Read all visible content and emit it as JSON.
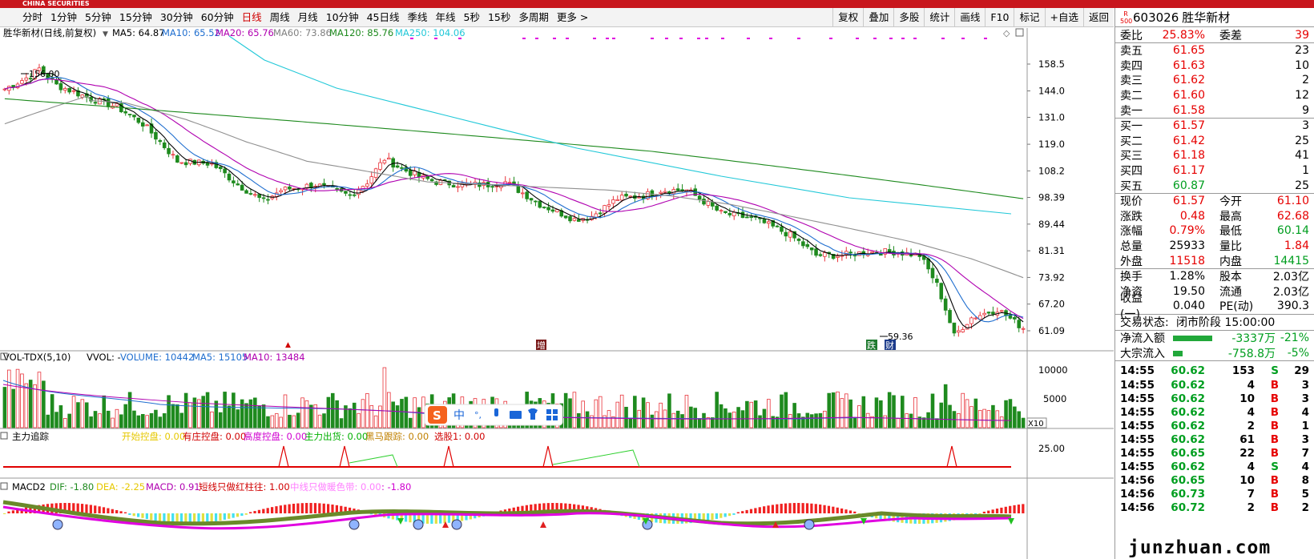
{
  "brand": {
    "name": "CHINA SECURITIES"
  },
  "toolbar": {
    "periods": [
      "分时",
      "1分钟",
      "5分钟",
      "15分钟",
      "30分钟",
      "60分钟",
      "日线",
      "周线",
      "月线",
      "10分钟",
      "45日线",
      "季线",
      "年线",
      "5秒",
      "15秒",
      "多周期",
      "更多 >"
    ],
    "active": "日线",
    "right_buttons": [
      "复权",
      "叠加",
      "多股",
      "统计",
      "画线",
      "F10",
      "标记",
      "+自选",
      "返回"
    ]
  },
  "kline": {
    "title": "胜华新材(日线,前复权)",
    "ma_labels": [
      {
        "text": "MA5: 64.87",
        "color": "#000000"
      },
      {
        "text": "MA10: 65.52",
        "color": "#1f6ecf"
      },
      {
        "text": "MA20: 65.76",
        "color": "#b000b0"
      },
      {
        "text": "MA60: 73.86",
        "color": "#808080"
      },
      {
        "text": "MA120: 85.76",
        "color": "#1e8a1e"
      },
      {
        "text": "MA250: 104.06",
        "color": "#21c8d8"
      }
    ],
    "price_ticks": [
      "158.5",
      "144.0",
      "131.0",
      "119.0",
      "108.2",
      "98.39",
      "89.44",
      "81.31",
      "73.92",
      "67.20",
      "61.09"
    ],
    "high_label": "156.00",
    "low_label": "59.36",
    "event_badges": [
      "增",
      "跌",
      "财"
    ]
  },
  "volume": {
    "title": "VOL-TDX(5,10)",
    "vvol": "VVOL: -",
    "volume": "VOLUME: 10442",
    "ma5": "MA5: 15105",
    "ma10": "MA10: 13484",
    "ticks": [
      "10000",
      "5000"
    ],
    "unit": "X10"
  },
  "zhuli": {
    "title": "主力追踪",
    "items": [
      {
        "text": "开始控盘: 0.00",
        "color": "#e6c800"
      },
      {
        "text": "有庄控盘: 0.00",
        "color": "#d00000"
      },
      {
        "text": "高度控盘: 0.00",
        "color": "#d000d0"
      },
      {
        "text": "主力出货: 0.00",
        "color": "#00b000"
      },
      {
        "text": "黑马跟踪: 0.00",
        "color": "#c08000"
      },
      {
        "text": "选股1: 0.00",
        "color": "#d00000"
      }
    ],
    "tick": "25.00"
  },
  "macd": {
    "title": "MACD2",
    "items": [
      {
        "text": "DIF: -1.80",
        "color": "#1e8a1e"
      },
      {
        "text": "DEA: -2.25",
        "color": "#e6c800"
      },
      {
        "text": "MACD: 0.91",
        "color": "#b000b0"
      },
      {
        "text": "短线只做红柱往: 1.00",
        "color": "#d00000"
      },
      {
        "text": "中线只做暖色带: 0.00",
        "color": "#ff80ff"
      },
      {
        "text": ": -1.80",
        "color": "#d000d0"
      }
    ]
  },
  "ime": {
    "chars": [
      "中",
      "°,"
    ]
  },
  "stock": {
    "code": "603026",
    "name": "胜华新材",
    "badge": "R 500"
  },
  "quote": {
    "weibi": {
      "label": "委比",
      "value": "25.83%",
      "label2": "委差",
      "value2": "39"
    },
    "asks": [
      {
        "label": "卖五",
        "price": "61.65",
        "vol": "23"
      },
      {
        "label": "卖四",
        "price": "61.63",
        "vol": "10"
      },
      {
        "label": "卖三",
        "price": "61.62",
        "vol": "2"
      },
      {
        "label": "卖二",
        "price": "61.60",
        "vol": "12"
      },
      {
        "label": "卖一",
        "price": "61.58",
        "vol": "9"
      }
    ],
    "bids": [
      {
        "label": "买一",
        "price": "61.57",
        "vol": "3"
      },
      {
        "label": "买二",
        "price": "61.42",
        "vol": "25"
      },
      {
        "label": "买三",
        "price": "61.18",
        "vol": "41"
      },
      {
        "label": "买四",
        "price": "61.17",
        "vol": "1"
      },
      {
        "label": "买五",
        "price": "60.87",
        "vol": "25"
      }
    ],
    "stats": [
      {
        "l": "现价",
        "v": "61.57",
        "vc": "red",
        "l2": "今开",
        "v2": "61.10",
        "v2c": "red"
      },
      {
        "l": "涨跌",
        "v": "0.48",
        "vc": "red",
        "l2": "最高",
        "v2": "62.68",
        "v2c": "red"
      },
      {
        "l": "涨幅",
        "v": "0.79%",
        "vc": "red",
        "l2": "最低",
        "v2": "60.14",
        "v2c": "green"
      },
      {
        "l": "总量",
        "v": "25933",
        "vc": "",
        "l2": "量比",
        "v2": "1.84",
        "v2c": "red"
      },
      {
        "l": "外盘",
        "v": "11518",
        "vc": "red",
        "l2": "内盘",
        "v2": "14415",
        "v2c": "green"
      }
    ],
    "stats2": [
      {
        "l": "换手",
        "v": "1.28%",
        "l2": "股本",
        "v2": "2.03亿"
      },
      {
        "l": "净资",
        "v": "19.50",
        "l2": "流通",
        "v2": "2.03亿"
      },
      {
        "l": "收益(一)",
        "v": "0.040",
        "l2": "PE(动)",
        "v2": "390.3"
      }
    ],
    "trade_status": {
      "label": "交易状态:",
      "value": "闭市阶段 15:00:00"
    },
    "flows": [
      {
        "label": "净流入额",
        "value": "-3337万",
        "pct": "-21%",
        "bar": 0.85
      },
      {
        "label": "大宗流入",
        "value": "-758.8万",
        "pct": "-5%",
        "bar": 0.2
      }
    ]
  },
  "ticks": [
    {
      "t": "14:55",
      "p": "60.62",
      "q": "153",
      "s": "S",
      "n": "29"
    },
    {
      "t": "14:55",
      "p": "60.62",
      "q": "4",
      "s": "B",
      "n": "3"
    },
    {
      "t": "14:55",
      "p": "60.62",
      "q": "10",
      "s": "B",
      "n": "3"
    },
    {
      "t": "14:55",
      "p": "60.62",
      "q": "4",
      "s": "B",
      "n": "4"
    },
    {
      "t": "14:55",
      "p": "60.62",
      "q": "2",
      "s": "B",
      "n": "1"
    },
    {
      "t": "14:55",
      "p": "60.62",
      "q": "61",
      "s": "B",
      "n": "3"
    },
    {
      "t": "14:55",
      "p": "60.65",
      "q": "22",
      "s": "B",
      "n": "7"
    },
    {
      "t": "14:55",
      "p": "60.62",
      "q": "4",
      "s": "S",
      "n": "4"
    },
    {
      "t": "14:56",
      "p": "60.65",
      "q": "10",
      "s": "B",
      "n": "8"
    },
    {
      "t": "14:56",
      "p": "60.73",
      "q": "7",
      "s": "B",
      "n": "5"
    },
    {
      "t": "14:56",
      "p": "60.72",
      "q": "2",
      "s": "B",
      "n": "2"
    }
  ],
  "watermark": "junzhuan.com"
}
